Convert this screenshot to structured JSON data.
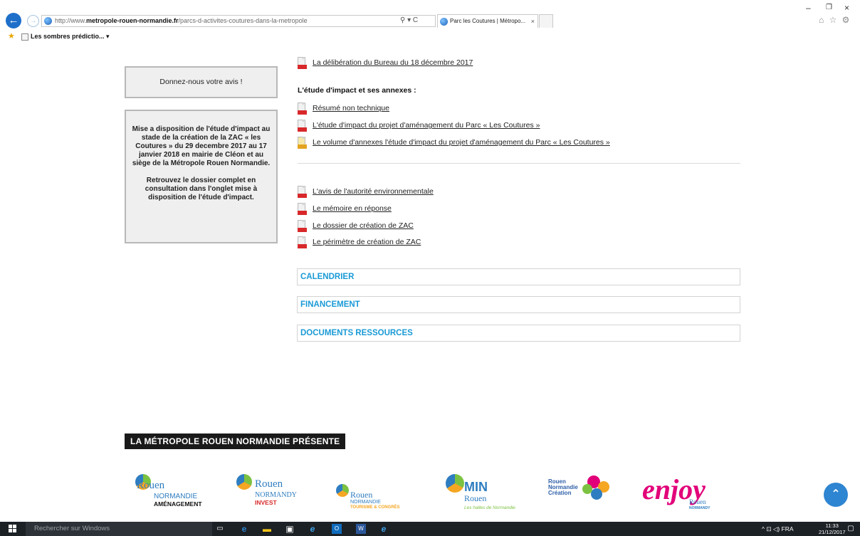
{
  "browser": {
    "url_prefix": "http://www.",
    "url_domain": "metropole-rouen-normandie.fr",
    "url_path": "/parcs-d-activites-coutures-dans-la-metropole",
    "search_tools": "⚲ ▾ C",
    "tab_title": "Parc les Coutures | Métropo...",
    "tab_close": "×",
    "favorite_label": "Les sombres prédictio... ▾",
    "minimize": "–",
    "restore": "❐",
    "close": "×",
    "right_icons": "⌂ ☆ ⚙"
  },
  "sidebar": {
    "feedback_label": "Donnez-nous votre avis !",
    "notice_p1": "Mise a disposition de l'étude d'impact au stade de la création de la ZAC « les Coutures » du 29 decembre 2017 au 17 janvier 2018 en mairie de Cléon et au siège de la Métropole Rouen Normandie.",
    "notice_p2": "Retrouvez le dossier complet en consultation dans l'onglet mise à disposition de l'étude d'impact."
  },
  "documents": {
    "top_link": "La délibération du Bureau du 18 décembre 2017",
    "impact_heading": "L'étude d'impact et ses annexes :",
    "impact_links": [
      "Résumé non technique",
      "L'étude d'impact du projet d'aménagement du Parc « Les Coutures »",
      "Le volume d'annexes l'étude d'impact du projet d'aménagement du Parc « Les Coutures »"
    ],
    "other_links": [
      "L'avis de l'autorité environnementale",
      "Le mémoire en réponse",
      "Le dossier de création de ZAC",
      "Le périmètre de création de ZAC"
    ]
  },
  "accordion": {
    "items": [
      "CALENDRIER",
      "FINANCEMENT",
      "DOCUMENTS RESSOURCES"
    ]
  },
  "footer": {
    "presents_label": "LA MÉTROPOLE ROUEN NORMANDIE PRÉSENTE",
    "logos": [
      {
        "line1": "Rouen",
        "line2": "NORMANDIE",
        "line3": "AMÉNAGEMENT"
      },
      {
        "line1": "Rouen",
        "line2": "NORMANDY",
        "line3": "INVEST"
      },
      {
        "line1": "Rouen",
        "line2": "NORMANDIE",
        "line3": "TOURISME & CONGRÈS"
      },
      {
        "line1": "MIN",
        "line2": "Rouen",
        "line3": "Les halles de Normandie"
      },
      {
        "line1": "Rouen",
        "line2": "Normandie",
        "line3": "Création"
      },
      {
        "line1": "enjoy",
        "line2": "Rouen",
        "line3": "NORMANDY"
      }
    ],
    "scroll_top": "⌃"
  },
  "taskbar": {
    "search_placeholder": "Rechercher sur Windows",
    "tray_text": "^ ⊡ ◁) FRA",
    "time": "11:33",
    "date": "21/12/2017"
  },
  "colors": {
    "accordion_text": "#1a9ad6",
    "pdf_red": "#d8282a",
    "taskbar_bg": "#1c2126"
  }
}
